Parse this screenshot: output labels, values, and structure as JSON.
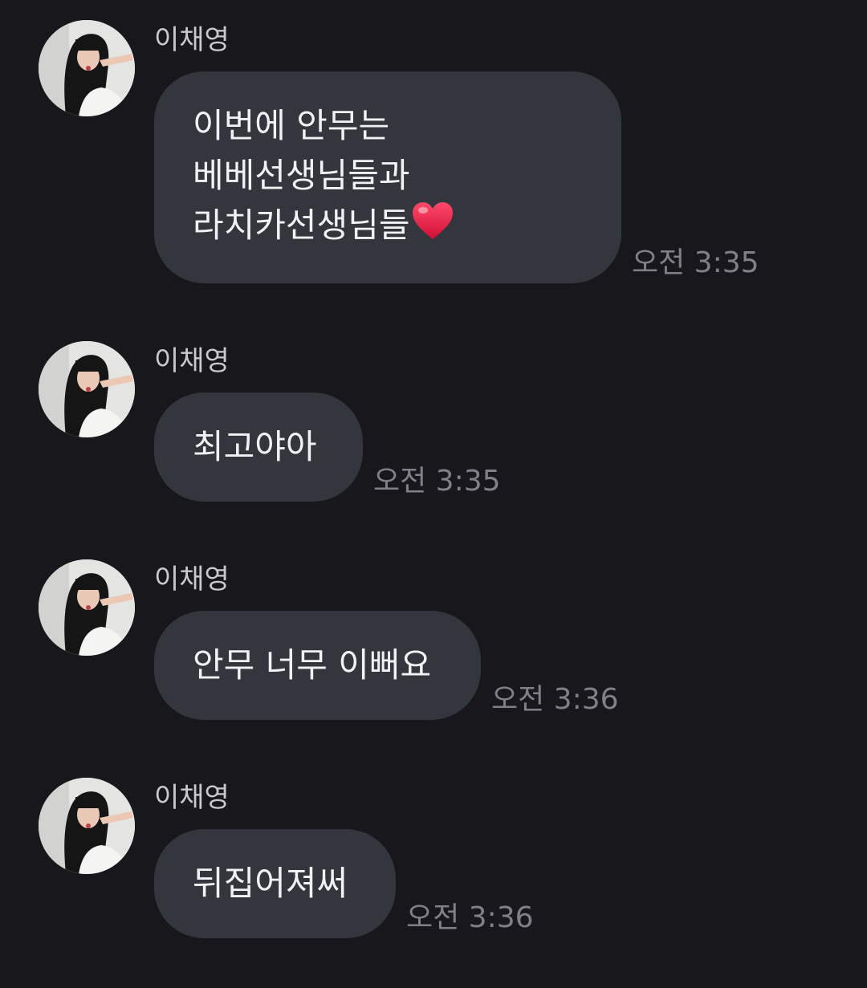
{
  "messages": [
    {
      "sender": "이채영",
      "lines": [
        "이번에 안무는",
        "베베선생님들과",
        "라치카선생님들"
      ],
      "trailing_icon": "heart-emoji",
      "time": "오전 3:35"
    },
    {
      "sender": "이채영",
      "lines": [
        "최고야아"
      ],
      "time": "오전 3:35"
    },
    {
      "sender": "이채영",
      "lines": [
        "안무 너무 이뻐요"
      ],
      "time": "오전 3:36"
    },
    {
      "sender": "이채영",
      "lines": [
        "뒤집어져써"
      ],
      "time": "오전 3:36"
    }
  ],
  "colors": {
    "background": "#17171c",
    "bubble": "#34363e",
    "message_text": "#f2f2f4",
    "sender_text": "#c9c9ce",
    "time_text": "#808088",
    "heart": "#e8193c"
  }
}
